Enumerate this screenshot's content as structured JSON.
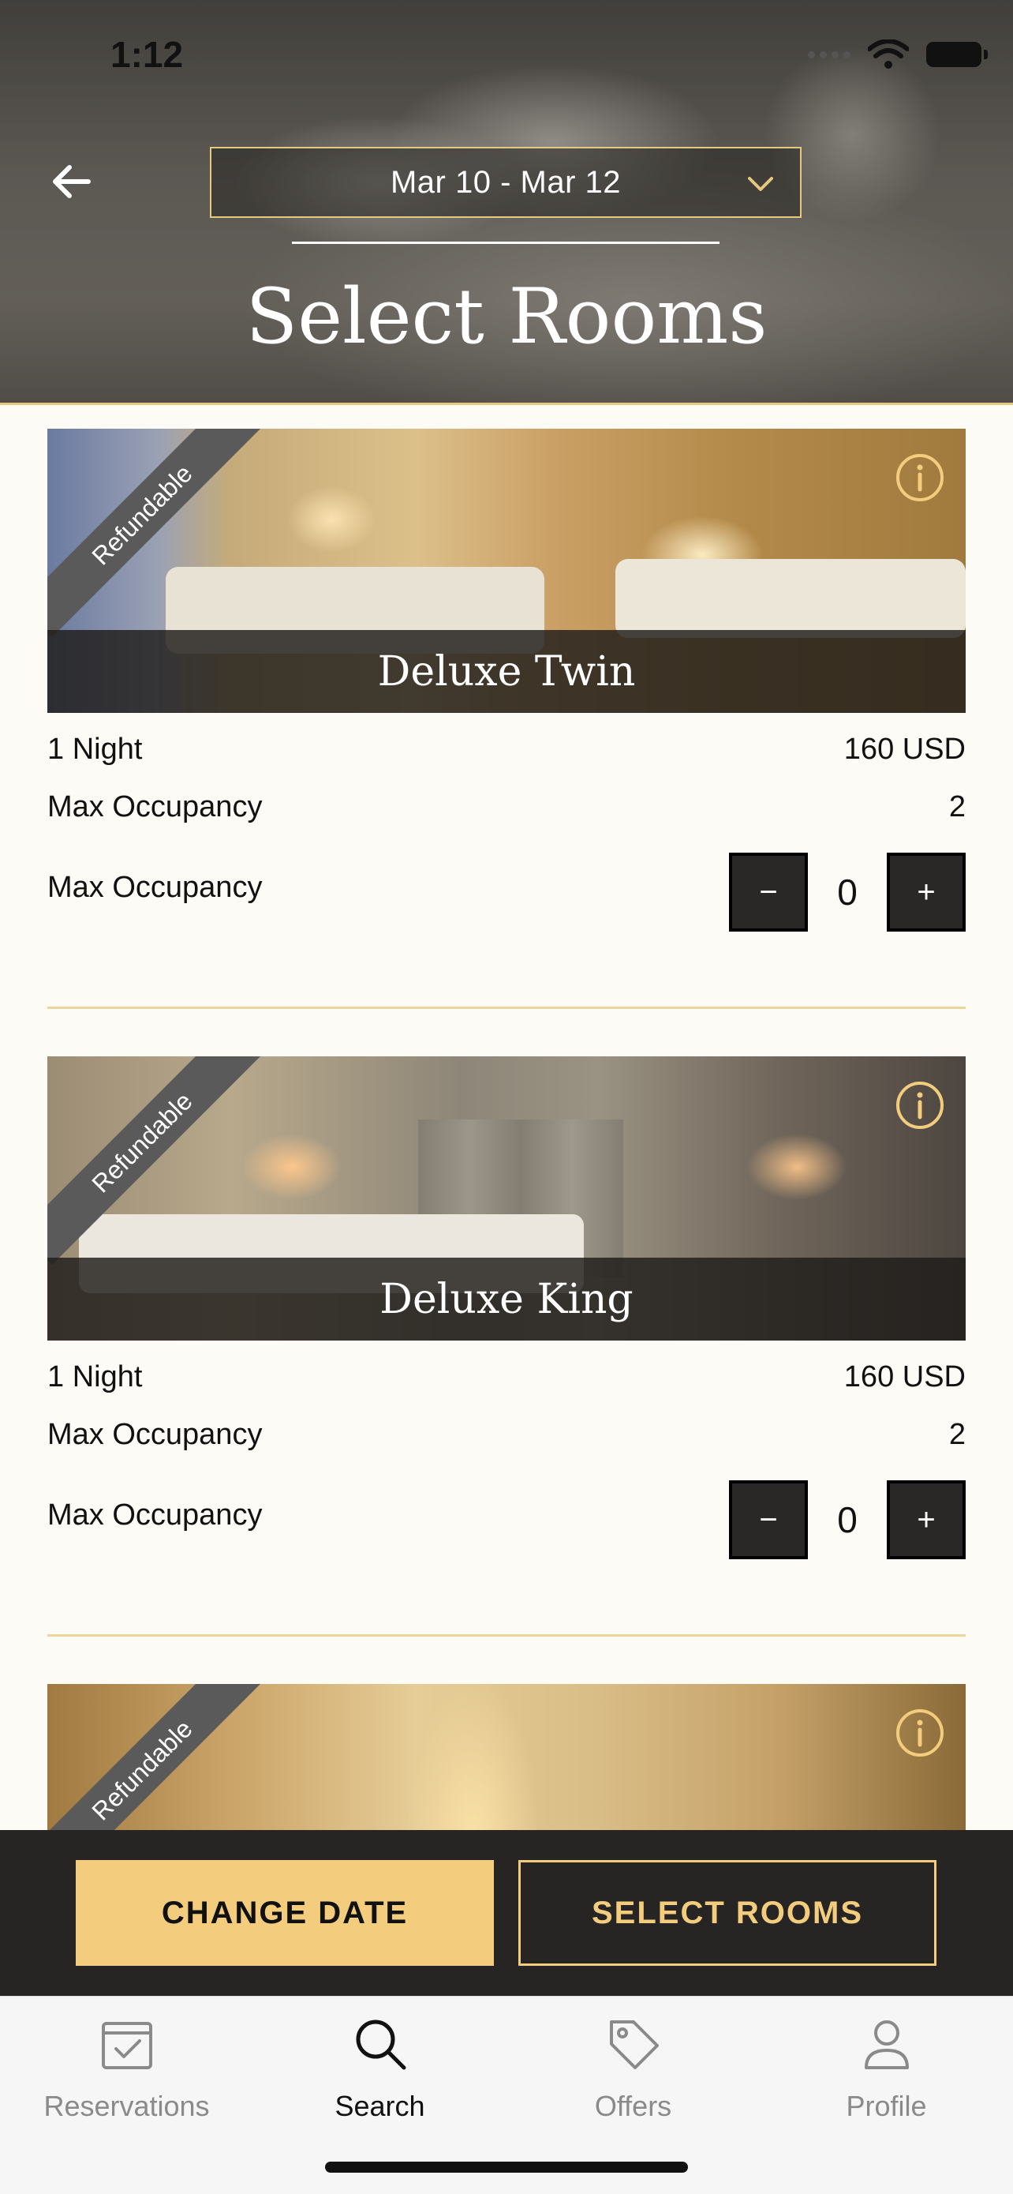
{
  "status_bar": {
    "time": "1:12"
  },
  "header": {
    "date_range": "Mar 10 - Mar 12",
    "title": "Select Rooms"
  },
  "rooms": [
    {
      "name": "Deluxe Twin",
      "badge": "Refundable",
      "nights_label": "1 Night",
      "price": "160 USD",
      "occupancy_label": "Max Occupancy",
      "occupancy_value": "2",
      "quantity_label": "Max Occupancy",
      "quantity": "0"
    },
    {
      "name": "Deluxe King",
      "badge": "Refundable",
      "nights_label": "1 Night",
      "price": "160 USD",
      "occupancy_label": "Max Occupancy",
      "occupancy_value": "2",
      "quantity_label": "Max Occupancy",
      "quantity": "0"
    },
    {
      "name": "",
      "badge": "Refundable"
    }
  ],
  "stepper": {
    "minus": "−",
    "plus": "+"
  },
  "actions": {
    "change_date": "CHANGE DATE",
    "select_rooms": "SELECT ROOMS"
  },
  "tabs": [
    {
      "label": "Reservations",
      "icon": "calendar-check-icon",
      "active": false
    },
    {
      "label": "Search",
      "icon": "search-icon",
      "active": true
    },
    {
      "label": "Offers",
      "icon": "tag-icon",
      "active": false
    },
    {
      "label": "Profile",
      "icon": "person-icon",
      "active": false
    }
  ],
  "colors": {
    "accent_gold": "#f3cd7d",
    "divider_gold": "#ecd59a",
    "dark": "#262523"
  }
}
